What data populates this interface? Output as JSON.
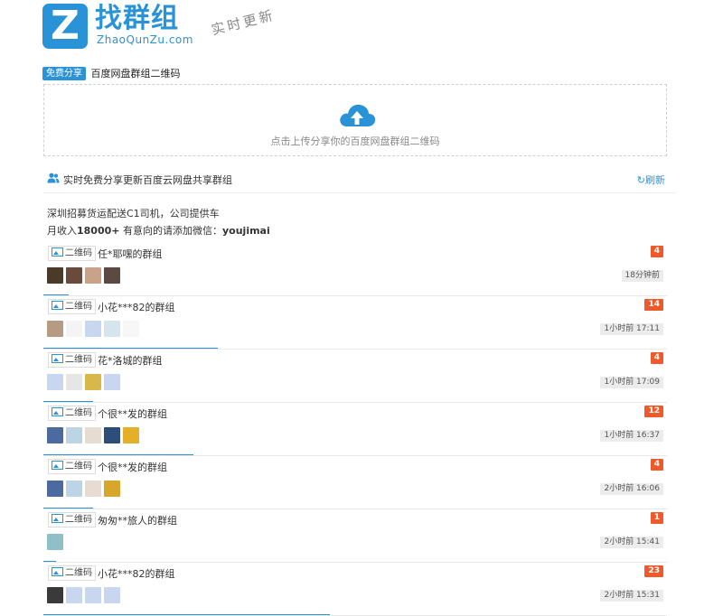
{
  "header": {
    "brand_cn": "找群组",
    "brand_en": "ZhaoQunZu.com",
    "slogan": "实时更新",
    "logo_letter": "Z"
  },
  "share": {
    "badge": "免费分享",
    "title": "百度网盘群组二维码"
  },
  "upload": {
    "text": "点击上传分享你的百度网盘群组二维码",
    "icon": "cloud-upload-icon"
  },
  "section": {
    "title": "实时免费分享更新百度云网盘共享群组",
    "refresh": "刷新"
  },
  "ad": {
    "line1": "深圳招募货运配送C1司机，公司提供车",
    "line2_prefix": "月收入",
    "line2_bold": "18000+",
    "line2_mid": " 有意向的请添加微信：",
    "line2_wechat": "youjimai"
  },
  "qr_label": "二维码",
  "accent": "#2a93d8",
  "count_color": "#f0592a",
  "groups": [
    {
      "name": "任*耶嘿的群组",
      "count": "4",
      "time": "18分钟前",
      "progress": 0.04,
      "avatars": [
        "#4a3a2a",
        "#6b4a3e",
        "#c9a28a",
        "#5a4a42"
      ]
    },
    {
      "name": "小花***82的群组",
      "count": "14",
      "time": "1小时前 17:11",
      "progress": 0.28,
      "avatars": [
        "#b69a82",
        "#f4f4f4",
        "#c8d6ef",
        "#d6e4ee",
        "#f7f7f7"
      ]
    },
    {
      "name": "花*洛城的群组",
      "count": "4",
      "time": "1小时前 17:09",
      "progress": 0.08,
      "avatars": [
        "#c8d6ef",
        "#e6e6e6",
        "#d8b84a",
        "#c8d6ef"
      ]
    },
    {
      "name": "个很**发的群组",
      "count": "12",
      "time": "1小时前 16:37",
      "progress": 0.24,
      "avatars": [
        "#4a6aa0",
        "#bcd4e4",
        "#e6dcd2",
        "#2e4e7a",
        "#e4b02a"
      ]
    },
    {
      "name": "个很**发的群组",
      "count": "4",
      "time": "2小时前 16:06",
      "progress": 0.08,
      "avatars": [
        "#4a6aa0",
        "#bcd4e4",
        "#e6dcd2",
        "#d8a62a"
      ]
    },
    {
      "name": "匆匆**旅人的群组",
      "count": "1",
      "time": "2小时前 15:41",
      "progress": 0.02,
      "avatars": [
        "#8fc0c8"
      ]
    },
    {
      "name": "小花***82的群组",
      "count": "23",
      "time": "2小时前 15:31",
      "progress": 0.46,
      "avatars": [
        "#3a3a3a",
        "#c8d6ef",
        "#c8d6ef",
        "#c8d6ef"
      ]
    }
  ]
}
